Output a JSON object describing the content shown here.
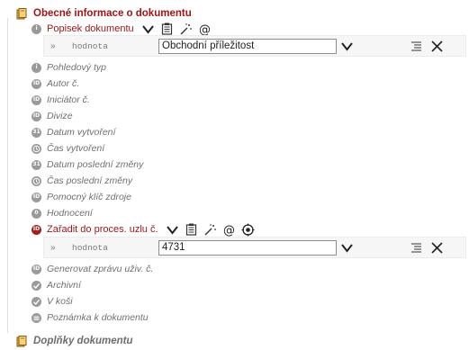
{
  "section_general": {
    "title": "Obecné informace o dokumentu"
  },
  "popisek": {
    "label": "Popisek dokumentu",
    "value_prefix": "»",
    "value_name": "hodnota",
    "value": "Obchodní příležitost"
  },
  "fields": [
    {
      "label": "Pohledový typ",
      "bullet": "i"
    },
    {
      "label": "Autor č.",
      "bullet": "ID"
    },
    {
      "label": "Iniciátor č.",
      "bullet": "ID"
    },
    {
      "label": "Divize",
      "bullet": "ID"
    },
    {
      "label": "Datum vytvoření",
      "bullet": "31"
    },
    {
      "label": "Čas vytvoření",
      "bullet": "clock"
    },
    {
      "label": "Datum poslední změny",
      "bullet": "31"
    },
    {
      "label": "Čas poslední změny",
      "bullet": "clock"
    },
    {
      "label": "Pomocný klíč zdroje",
      "bullet": "ID"
    },
    {
      "label": "Hodnocení",
      "bullet": "0"
    }
  ],
  "zaradit": {
    "label": "Zařadit do proces. uzlu č.",
    "value_prefix": "»",
    "value_name": "hodnota",
    "value": "4731"
  },
  "fields2": [
    {
      "label": "Generovat zprávu uživ. č.",
      "bullet": "ID"
    },
    {
      "label": "Archivní",
      "bullet": "check"
    },
    {
      "label": "V koši",
      "bullet": "check"
    },
    {
      "label": "Poznámka k dokumentu",
      "bullet": "lines"
    }
  ],
  "section_addons": {
    "title": "Doplňky dokumentu"
  },
  "icons": [
    "book-icon",
    "chevron-down-icon",
    "notes-icon",
    "sparkle-icon",
    "at-icon",
    "target-icon",
    "list-icon",
    "close-icon"
  ],
  "colors": {
    "accent_red": "#9b1515",
    "bullet_gray": "#9a9a9a",
    "value_bg": "#f6f6f6"
  }
}
